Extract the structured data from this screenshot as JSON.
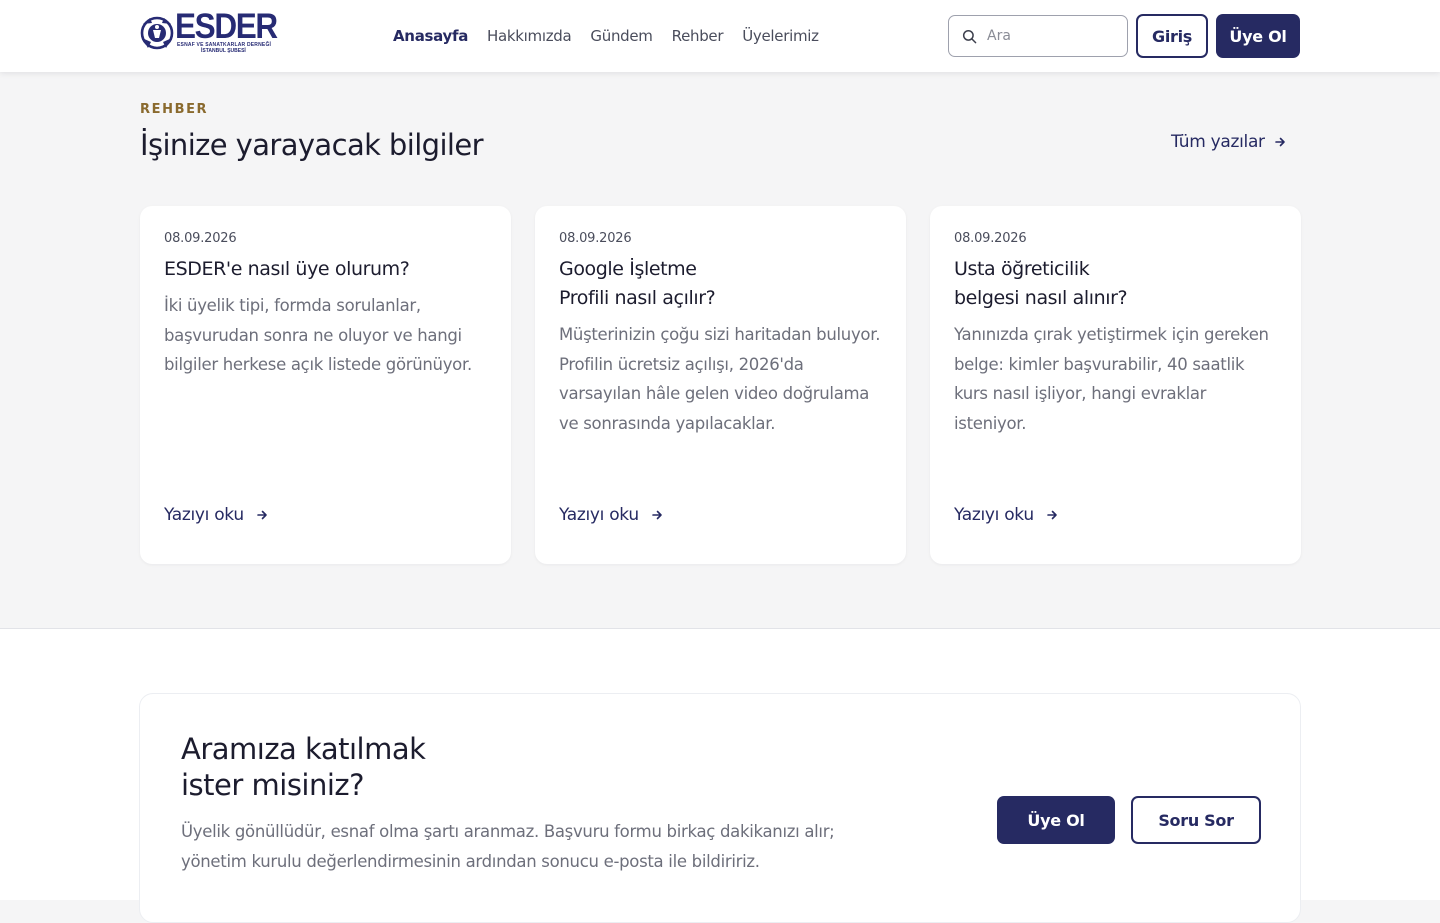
{
  "header": {
    "logo": {
      "word": "ESDER",
      "subtitle": "ESNAF VE SANATKARLAR DERNEĞİ",
      "subtitle2": "İSTANBUL ŞUBESİ",
      "icon": "emblem-icon"
    },
    "nav": [
      {
        "label": "Anasayfa",
        "active": true
      },
      {
        "label": "Hakkımızda",
        "active": false
      },
      {
        "label": "Gündem",
        "active": false
      },
      {
        "label": "Rehber",
        "active": false
      },
      {
        "label": "Üyelerimiz",
        "active": false
      }
    ],
    "search": {
      "placeholder": "Ara",
      "value": "",
      "icon": "search-icon"
    },
    "login_label": "Giriş",
    "join_label": "Üye Ol"
  },
  "guide": {
    "eyebrow": "REHBER",
    "title": "İşinize yarayacak bilgiler",
    "all_posts_label": "Tüm yazılar",
    "cards": [
      {
        "date": "08.09.2026",
        "title": "ESDER'e nasıl üye olurum?",
        "text": "İki üyelik tipi, formda sorulanlar, başvurudan sonra ne oluyor ve hangi bilgiler herkese açık listede görünüyor.",
        "link_label": "Yazıyı oku"
      },
      {
        "date": "08.09.2026",
        "title": "Google İşletme\nProfili nasıl açılır?",
        "text": "Müşterinizin çoğu sizi haritadan buluyor. Profilin ücretsiz açılışı, 2026'da varsayılan hâle gelen video doğrulama ve sonrasında yapılacaklar.",
        "link_label": "Yazıyı oku"
      },
      {
        "date": "08.09.2026",
        "title": "Usta öğreticilik\nbelgesi nasıl alınır?",
        "text": "Yanınızda çırak yetiştirmek için gereken belge: kimler başvurabilir, 40 saatlik kurs nasıl işliyor, hangi evraklar isteniyor.",
        "link_label": "Yazıyı oku"
      }
    ]
  },
  "cta": {
    "title": "Aramıza katılmak\nister misiniz?",
    "text": "Üyelik gönüllüdür, esnaf olma şartı aranmaz. Başvuru formu birkaç dakikanızı alır; yönetim kurulu değerlendirmesinin ardından sonucu e-posta ile bildiririz.",
    "join_label": "Üye Ol",
    "ask_label": "Soru Sor"
  },
  "colors": {
    "brand": "#262a62",
    "eyebrow": "#8a6a2e",
    "page_bg": "#f5f5f6",
    "body_text": "#6d6f7b"
  }
}
